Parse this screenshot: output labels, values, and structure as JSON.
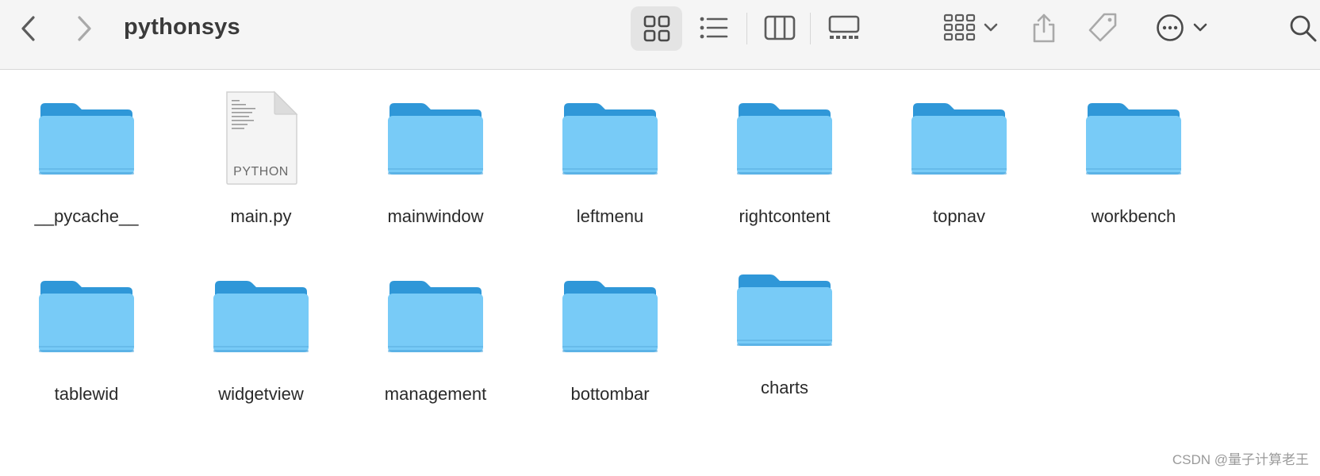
{
  "window": {
    "title": "pythonsys"
  },
  "toolbar": {
    "back_icon": "chevron-left-icon",
    "forward_icon": "chevron-right-icon",
    "views": [
      {
        "name": "icon-view",
        "icon": "grid-icon",
        "selected": true
      },
      {
        "name": "list-view",
        "icon": "list-icon",
        "selected": false
      },
      {
        "name": "column-view",
        "icon": "columns-icon",
        "selected": false
      },
      {
        "name": "gallery-view",
        "icon": "gallery-icon",
        "selected": false
      }
    ],
    "group_icon": "group-grid-icon",
    "share_icon": "share-icon",
    "tag_icon": "tag-icon",
    "more_icon": "ellipsis-circle-icon",
    "search_icon": "search-icon"
  },
  "items": [
    {
      "name": "__pycache__",
      "type": "folder"
    },
    {
      "name": "main.py",
      "type": "file",
      "badge": "PYTHON"
    },
    {
      "name": "mainwindow",
      "type": "folder"
    },
    {
      "name": "leftmenu",
      "type": "folder"
    },
    {
      "name": "rightcontent",
      "type": "folder"
    },
    {
      "name": "topnav",
      "type": "folder"
    },
    {
      "name": "workbench",
      "type": "folder"
    },
    {
      "name": "tablewid",
      "type": "folder"
    },
    {
      "name": "widgetview",
      "type": "folder"
    },
    {
      "name": "management",
      "type": "folder"
    },
    {
      "name": "bottombar",
      "type": "folder"
    },
    {
      "name": "charts",
      "type": "folder"
    }
  ],
  "watermark": "CSDN @量子计算老王",
  "colors": {
    "folder_front": "#78cbf7",
    "folder_back": "#2f97d8",
    "toolbar_bg": "#f5f5f5",
    "icon_gray": "#6b6b6b"
  }
}
